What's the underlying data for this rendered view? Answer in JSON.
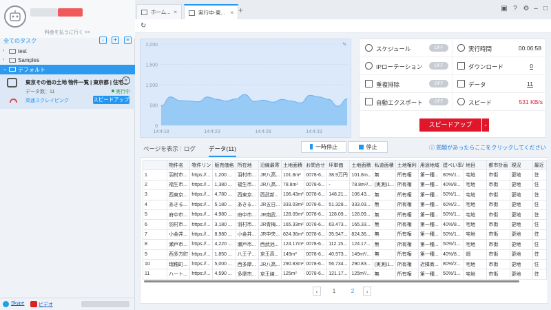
{
  "sidebar": {
    "pay_link": "料金を払うに行く >>",
    "all_tasks": "全てのタスク",
    "folders": [
      {
        "label": "test"
      },
      {
        "label": "Samples"
      },
      {
        "label": "デフォルト"
      }
    ],
    "task": {
      "name": "東京その他の土地 物件一覧 | 東京都 | 住宅...",
      "data_count": "データ数：11",
      "status": "実行中",
      "mode": "高速スクレイピング",
      "speedup": "スピードアップ"
    },
    "footer": {
      "skype": "Skype",
      "video": "ビデオ"
    }
  },
  "tabs": [
    {
      "label": "ホーム..."
    },
    {
      "label": "実行中-東..."
    }
  ],
  "chart_data": {
    "type": "area",
    "x_ticks": [
      "14:4:18",
      "14:4:23",
      "14:4:28",
      "14:4:33"
    ],
    "y_ticks": [
      "0",
      "500",
      "1,000",
      "1,500",
      "2,000"
    ],
    "ylim": [
      0,
      2000
    ],
    "values": [
      480,
      700,
      610,
      600,
      580,
      700,
      640,
      600,
      650,
      760,
      590,
      620,
      570,
      640,
      600,
      550,
      740,
      700,
      640,
      470,
      650
    ],
    "color": "#8cc4f5"
  },
  "stats": {
    "schedule": {
      "label": "スケジュール",
      "toggle": "OFF"
    },
    "ip_rotation": {
      "label": "IPローテーション",
      "toggle": "OFF"
    },
    "dedupe": {
      "label": "重複排除",
      "toggle": "OFF"
    },
    "auto_export": {
      "label": "自動エクスポート",
      "toggle": "OFF"
    },
    "runtime": {
      "label": "実行時間",
      "value": "00:06:58"
    },
    "download": {
      "label": "ダウンロード",
      "value": "0"
    },
    "data": {
      "label": "データ",
      "value": "11"
    },
    "speed": {
      "label": "スピード",
      "value": "531 KB/s"
    },
    "speedup_button": "スピードアップ"
  },
  "data_tabs": {
    "preview": "ページを表示",
    "log": "ログ",
    "data": "データ(11)",
    "pause": "一時停止",
    "stop": "停止",
    "help": "問題があったらここをクリックしてください"
  },
  "table": {
    "headers": [
      "",
      "物件名",
      "物件リン",
      "販売価格",
      "所在地",
      "沿線最寄",
      "土地面積",
      "お問合せ",
      "坪単価",
      "土地面積",
      "私道面積",
      "土地権利",
      "用途地域",
      "建ぺい率/",
      "地目",
      "都市計画",
      "現況",
      "最近"
    ],
    "rows": [
      [
        "1",
        "羽村市...",
        "https://...",
        "1,200 ...",
        "羽村市...",
        "JR八高...",
        "101.8m²",
        "0078-6...",
        "38.9万円",
        "101.8m...",
        "無",
        "所有権",
        "第一種...",
        "80%/1...",
        "宅地",
        "市街",
        "更地",
        "住"
      ],
      [
        "2",
        "福生市...",
        "https://...",
        "1,380 ...",
        "福生市...",
        "JR八高...",
        "78.8m²",
        "0078-6...",
        "-",
        "78.8m²/...",
        "(実測)1...",
        "所有権",
        "第一種...",
        "40%/8...",
        "宅地",
        "市街",
        "更地",
        "住"
      ],
      [
        "3",
        "西東京...",
        "https://...",
        "4,780 ...",
        "西東京...",
        "西武新...",
        "106.43m²",
        "0078-6...",
        "148.21...",
        "106.43...",
        "無",
        "所有権",
        "第一種...",
        "50%/1...",
        "宅地",
        "市街",
        "更地",
        "住"
      ],
      [
        "4",
        "あきる...",
        "https://...",
        "5,180 ...",
        "あきる...",
        "JR五日...",
        "333.03m²",
        "0078-6...",
        "51.328...",
        "333.03...",
        "無",
        "所有権",
        "第一種...",
        "60%/2...",
        "宅地",
        "市街",
        "更地",
        "住"
      ],
      [
        "5",
        "府中市...",
        "https://...",
        "4,980 ...",
        "府中市...",
        "JR南武...",
        "128.09m²",
        "0078-6...",
        "128.09...",
        "128.09...",
        "無",
        "所有権",
        "第一種...",
        "50%/1...",
        "宅地",
        "市街",
        "更地",
        "住"
      ],
      [
        "6",
        "羽村市...",
        "https://...",
        "3,180 ...",
        "羽村市...",
        "JR青梅...",
        "165.33m²",
        "0078-6...",
        "63.473...",
        "165.33...",
        "無",
        "所有権",
        "第一種...",
        "40%/8...",
        "宅地",
        "市街",
        "更地",
        "住"
      ],
      [
        "7",
        "小金井...",
        "https://...",
        "8,980 ...",
        "小金井...",
        "JR中央...",
        "824.36m²",
        "0078-6...",
        "35.947...",
        "824.36...",
        "無",
        "所有権",
        "第一種...",
        "50%/1...",
        "宅地",
        "市街",
        "更地",
        "住"
      ],
      [
        "8",
        "瀬戸市...",
        "https://...",
        "4,220 ...",
        "瀬戸市...",
        "西武池...",
        "124.17m²",
        "0078-6...",
        "112.15...",
        "124.17...",
        "無",
        "所有権",
        "第一種...",
        "50%/1...",
        "宅地",
        "市街",
        "更地",
        "住"
      ],
      [
        "9",
        "西多方町",
        "https://...",
        "1,850 ...",
        "八王子...",
        "京王高...",
        "149m²",
        "0078-6...",
        "40.973...",
        "149m²/...",
        "無",
        "所有権",
        "第一種...",
        "40%/8...",
        "畑",
        "市街",
        "更地",
        "住"
      ],
      [
        "10",
        "瑞穂町...",
        "https://...",
        "5,000 ...",
        "西多摩...",
        "JR八高...",
        "290.83m²",
        "0078-6...",
        "56.734...",
        "290.83...",
        "(実測)1...",
        "所有権",
        "近隣商...",
        "80%/2...",
        "宅地",
        "市街",
        "更地",
        "住"
      ],
      [
        "11",
        "ハート...",
        "https://...",
        "4,590 ...",
        "多摩市...",
        "京王線...",
        "125m²",
        "0078-6...",
        "121.17...",
        "125m²/...",
        "無",
        "所有権",
        "第一種...",
        "50%/1...",
        "宅地",
        "市街",
        "更地",
        "住"
      ]
    ]
  },
  "pager": {
    "page1": "1",
    "page2": "2"
  }
}
